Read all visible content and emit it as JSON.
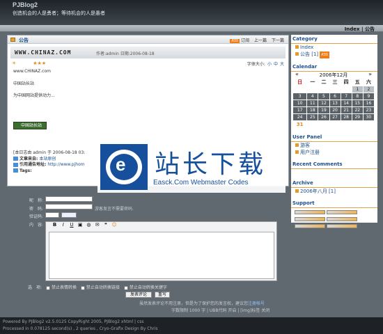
{
  "header": {
    "title": "PJBlog2",
    "slogan": "创造机会的人是勇者；等待机会的人是愚者"
  },
  "nav": {
    "index_link": "Index | 公告"
  },
  "post": {
    "category": "公告",
    "tools": [
      "订阅",
      "上一篇",
      "下一篇"
    ],
    "site_name": "WWW.CHINAZ.COM",
    "meta": "作者:admin 日期:2006-08-18",
    "font_size_label": "字体大小:",
    "font_sizes": [
      "小",
      "中",
      "大"
    ],
    "lines": [
      "www.CHINAZ.com",
      "中国站长站",
      "为中国网站提供动力..."
    ],
    "badge_text": "中国站长站",
    "footer_line1": "[本日志由 admin 于 2006-08-18 03:",
    "source_label": "文章来自:",
    "source_link": "本站原创",
    "trackback_label": "引用通告地址:",
    "trackback_url": "http://www.pjhom",
    "tags_label": "Tags:"
  },
  "sidebar": {
    "category_title": "Category",
    "category_items": [
      "Index",
      "公告 [1]"
    ],
    "rss": "RSS",
    "calendar_title": "Calendar",
    "month_label": "2006年12月",
    "prev": "«",
    "next": "»",
    "weekdays": [
      "日",
      "一",
      "二",
      "三",
      "四",
      "五",
      "六"
    ],
    "weeks": [
      [
        "",
        "",
        "",
        "",
        "",
        "1",
        "2"
      ],
      [
        "3",
        "4",
        "5",
        "6",
        "7",
        "8",
        "9"
      ],
      [
        "10",
        "11",
        "12",
        "13",
        "14",
        "15",
        "16"
      ],
      [
        "17",
        "18",
        "19",
        "20",
        "21",
        "22",
        "23"
      ],
      [
        "24",
        "25",
        "26",
        "27",
        "28",
        "29",
        "30"
      ],
      [
        "31",
        "",
        "",
        "",
        "",
        "",
        ""
      ]
    ],
    "user_panel_title": "User Panel",
    "user_items": [
      "游客",
      "用户注册"
    ],
    "recent_comments_title": "Recent Comments",
    "archive_title": "Archive",
    "archive_items": [
      "2006年八月 [1]"
    ],
    "support_title": "Support"
  },
  "watermark": {
    "cn": "站长下载",
    "en": "Easck.Com Webmaster Codes",
    "mark": "e"
  },
  "form": {
    "name_label": "昵　称:",
    "password_label": "密　码:",
    "password_note": "游客发言不需要密码.",
    "verify_label": "验证码:",
    "content_label": "内　容:",
    "toolbar": [
      "B",
      "I",
      "U"
    ],
    "options_label": "选　项:",
    "options": [
      "禁止表情转换",
      "禁止自动转换链接",
      "禁止自动转换关键字"
    ],
    "submit": "发表评论",
    "reset": "重写",
    "tip": "虽然发表评论不用注册，但是为了保护您的发言权，建议您",
    "tip_link": "注册帐号",
    "limits": "字数限制 1000 字 | UBB代码 开启 | [img]标签 关闭"
  },
  "footer": {
    "line1": "Powered By PJBlog2 v2.5.0125 CopyRight 2005, PJBlog2 xhtml | css",
    "line2": "Processed in 0.078125 second(s) , 2 queries , Cryo-Grafix Design By Chris"
  }
}
